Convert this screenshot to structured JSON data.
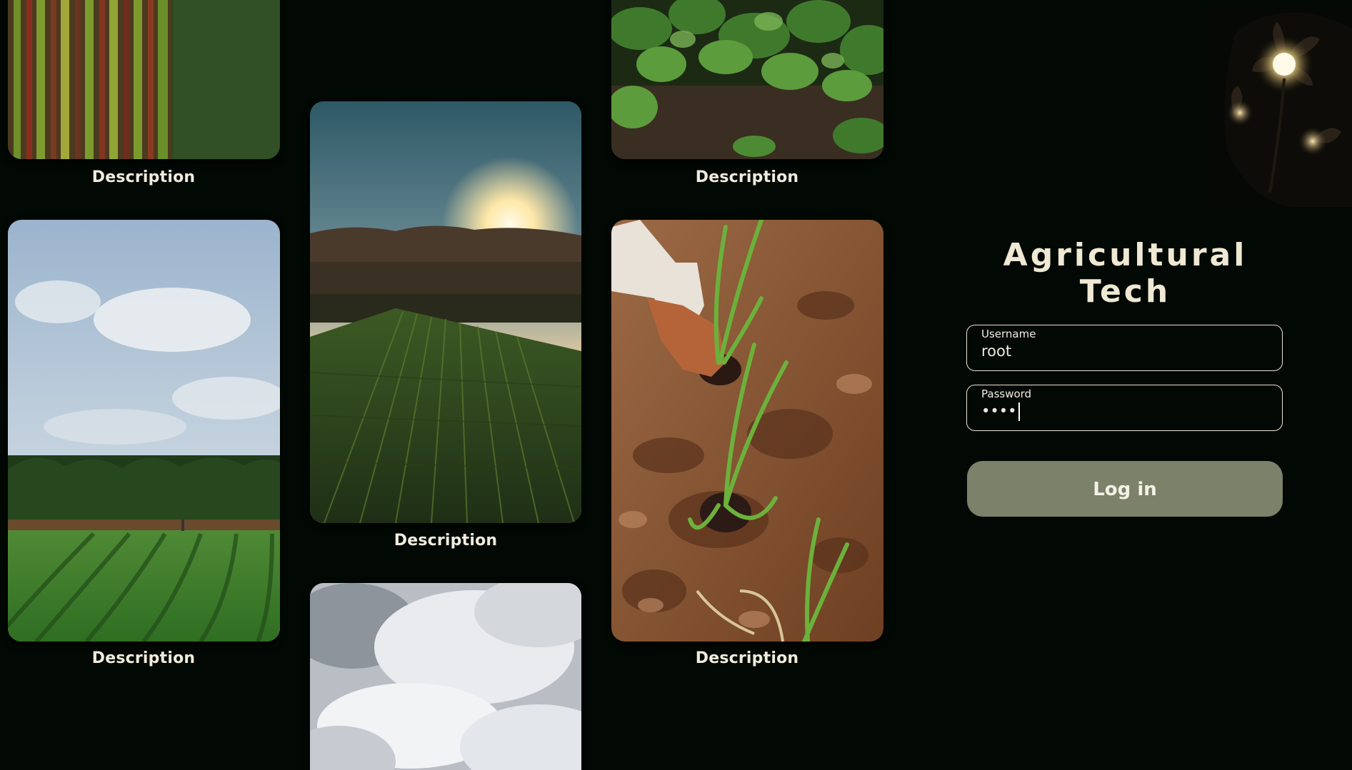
{
  "app": {
    "title": "Agricultural Tech"
  },
  "gallery": {
    "cards": [
      {
        "caption": "Description",
        "image": "aerial-crop-rows"
      },
      {
        "caption": "Description",
        "image": "sunset-green-field"
      },
      {
        "caption": "Description",
        "image": "leafy-seedlings"
      },
      {
        "caption": "Description",
        "image": "crop-rows-under-sky"
      },
      {
        "caption": "Description",
        "image": "hand-planting-onion"
      },
      {
        "caption": "",
        "image": "cloudy-sky"
      }
    ]
  },
  "login": {
    "username_label": "Username",
    "username_value": "root",
    "password_label": "Password",
    "password_value": "••••",
    "submit_label": "Log in"
  },
  "colors": {
    "background": "#020804",
    "accent_button": "#7c816a",
    "text": "#efe8d2"
  },
  "icons": {
    "logo": "glowing-flower-logo"
  }
}
